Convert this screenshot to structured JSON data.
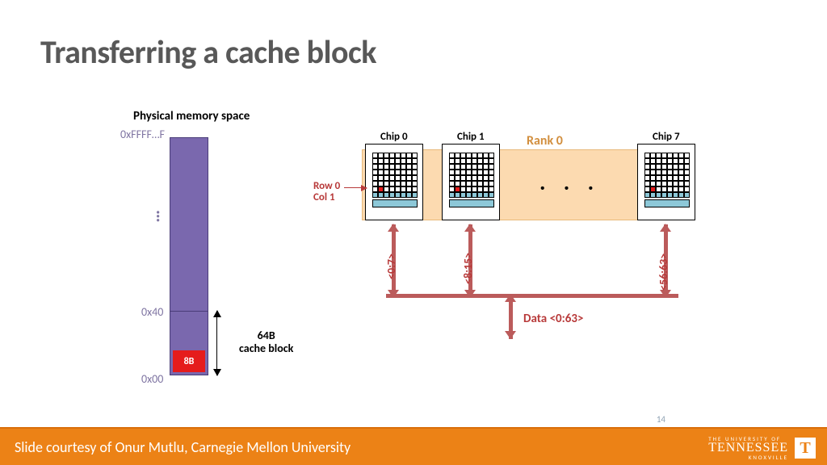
{
  "title": "Transferring a cache block",
  "memory": {
    "heading": "Physical memory space",
    "addr_top": "0xFFFF…F",
    "addr_40": "0x40",
    "addr_00": "0x00",
    "block_label": "64B\ncache block",
    "byte_label": "8B"
  },
  "rank": {
    "label": "Rank 0",
    "rowcol": "Row 0\nCol 1",
    "chips": [
      "Chip 0",
      "Chip 1",
      "Chip 7"
    ],
    "lanes": [
      "<0:7>",
      "<8:15>",
      "<56:63>"
    ],
    "data_label": "Data <0:63>"
  },
  "footer": {
    "credit": "Slide courtesy of Onur Mutlu, Carnegie Mellon University",
    "page": "14",
    "univ_top": "THE UNIVERSITY OF",
    "univ_mid": "TENNESSEE",
    "univ_bot": "KNOXVILLE",
    "logo": "T"
  }
}
